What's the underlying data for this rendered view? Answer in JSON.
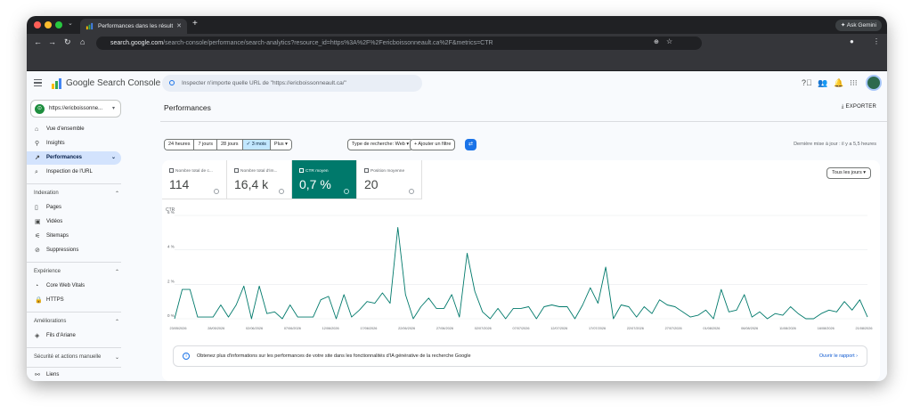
{
  "browser": {
    "tab_title": "Performances dans les résult",
    "gemini_label": "Ask Gemini",
    "url_host": "search.google.com",
    "url_path": "/search-console/performance/search-analytics?resource_id=https%3A%2F%2Fericboissonneault.ca%2F&metrics=CTR"
  },
  "app": {
    "brand": "Google Search Console",
    "url_placeholder": "Inspecter n'importe quelle URL de \"https://ericboissonneault.ca/\""
  },
  "sidebar": {
    "property": "https://ericboissonne...",
    "items": [
      {
        "label": "Vue d'ensemble",
        "icon": "⌂"
      },
      {
        "label": "Insights",
        "icon": "⚲"
      },
      {
        "label": "Performances",
        "icon": "↗"
      },
      {
        "label": "Inspection de l'URL",
        "icon": "🔍"
      }
    ],
    "sections": [
      {
        "title": "Indexation",
        "items": [
          {
            "label": "Pages",
            "icon": "▯"
          },
          {
            "label": "Vidéos",
            "icon": "▣"
          },
          {
            "label": "Sitemaps",
            "icon": "⚟"
          },
          {
            "label": "Suppressions",
            "icon": "⊘"
          }
        ]
      },
      {
        "title": "Expérience",
        "items": [
          {
            "label": "Core Web Vitals",
            "icon": "◔"
          },
          {
            "label": "HTTPS",
            "icon": "🔒"
          }
        ]
      },
      {
        "title": "Améliorations",
        "items": [
          {
            "label": "Fils d'Ariane",
            "icon": "◈"
          }
        ]
      },
      {
        "title": "Sécurité et actions manuelle",
        "items": []
      }
    ],
    "links_label": "Liens"
  },
  "main": {
    "title": "Performances",
    "export_label": "EXPORTER",
    "date_filters": [
      "24 heures",
      "7 jours",
      "28 jours",
      "✓ 3 mois",
      "Plus ▾"
    ],
    "search_type": "Type de recherche: Web ▾",
    "add_filter": "+ Ajouter un filtre",
    "last_update": "Dernière mise à jour : il y a 5,5 heures",
    "device_select": "Tous les jours ▾",
    "metrics": [
      {
        "label": "Nombre total de c...",
        "value": "114",
        "selected": false
      },
      {
        "label": "Nombre total d'im...",
        "value": "16,4 k",
        "selected": false
      },
      {
        "label": "CTR moyen",
        "value": "0,7 %",
        "selected": true
      },
      {
        "label": "Position moyenne",
        "value": "20",
        "selected": false
      }
    ],
    "banner_text": "Obtenez plus d'informations sur les performances de votre site dans les fonctionnalités d'IA générative de la recherche Google",
    "banner_link": "Ouvrir le rapport ›"
  },
  "chart_data": {
    "type": "line",
    "ylabel": "CTR",
    "yticks": [
      "0 %",
      "2 %",
      "4 %",
      "6 %"
    ],
    "ylim": [
      0,
      6
    ],
    "xtick_labels": [
      "23/05/2026",
      "28/05/2026",
      "02/06/2026",
      "07/06/2026",
      "12/06/2026",
      "17/06/2026",
      "22/06/2026",
      "27/06/2026",
      "02/07/2026",
      "07/07/2026",
      "12/07/2026",
      "17/07/2026",
      "22/07/2026",
      "27/07/2026",
      "01/08/2026",
      "06/08/2026",
      "11/08/2026",
      "16/08/2026",
      "21/08/2026"
    ],
    "series": [
      {
        "color": "#00796b",
        "values": [
          0.0,
          1.7,
          1.7,
          0.1,
          0.1,
          0.1,
          0.8,
          0.1,
          0.8,
          1.9,
          0.0,
          1.9,
          0.3,
          0.4,
          0.0,
          0.8,
          0.1,
          0.1,
          0.1,
          1.1,
          1.3,
          0.0,
          1.4,
          0.1,
          0.5,
          1.0,
          0.9,
          1.5,
          0.9,
          5.3,
          1.4,
          0.0,
          0.7,
          1.2,
          0.6,
          0.6,
          1.4,
          0.1,
          3.8,
          1.6,
          0.4,
          0.0,
          0.6,
          0.0,
          0.6,
          0.6,
          0.7,
          0.0,
          0.7,
          0.8,
          0.7,
          0.7,
          0.0,
          0.8,
          1.8,
          0.9,
          3.0,
          0.0,
          0.8,
          0.7,
          0.1,
          0.7,
          0.3,
          1.1,
          0.8,
          0.7,
          0.4,
          0.1,
          0.2,
          0.5,
          0.0,
          1.7,
          0.4,
          0.5,
          1.4,
          0.1,
          0.4,
          0.0,
          0.3,
          0.2,
          0.7,
          0.3,
          0.0,
          0.0,
          0.3,
          0.5,
          0.4,
          1.0,
          0.5,
          1.1,
          0.1
        ]
      }
    ]
  }
}
